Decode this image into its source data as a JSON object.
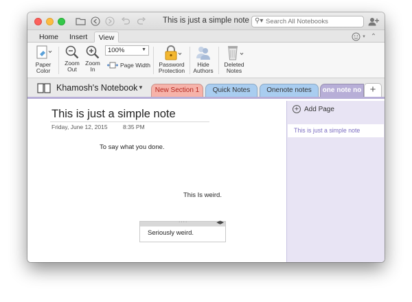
{
  "window": {
    "title": "This is just a simple note",
    "search": {
      "placeholder": "Search All Notebooks"
    }
  },
  "titlebar_icons": [
    "folder-icon",
    "back-arrow-icon",
    "forward-arrow-icon",
    "undo-icon",
    "redo-icon",
    "share-person-icon"
  ],
  "ribbon": {
    "tabs": [
      "Home",
      "Insert",
      "View"
    ],
    "active_tab": "View",
    "buttons": {
      "paper_color": "Paper Color",
      "zoom_out": "Zoom Out",
      "zoom_in": "Zoom In",
      "zoom_level": "100%",
      "page_width": "Page Width",
      "password_protection": "Password Protection",
      "hide_authors": "Hide Authors",
      "deleted_notes": "Deleted Notes"
    }
  },
  "notebook": {
    "name": "Khamosh's Notebook",
    "sections": [
      {
        "label": "New Section 1",
        "color": "#f6b3aa"
      },
      {
        "label": "Quick Notes",
        "color": "#a9cdf0"
      },
      {
        "label": "Onenote notes",
        "color": "#a9cdf0"
      },
      {
        "label": "one note no",
        "color": "#b7aed7"
      }
    ],
    "active_section": "one note no",
    "add_section": "+"
  },
  "note": {
    "title": "This is just a simple note",
    "date": "Friday, June 12, 2015",
    "time": "8:35 PM",
    "text1": "To say what you done.",
    "text2": "This Is weird.",
    "text3": "Seriously weird."
  },
  "pages": {
    "add_page": "Add Page",
    "items": [
      "This is just a simple note"
    ]
  },
  "colors": {
    "accent_section": "#b7aed7",
    "page_pane": "#e8e4f4",
    "page_item_text": "#7a6cc0"
  }
}
